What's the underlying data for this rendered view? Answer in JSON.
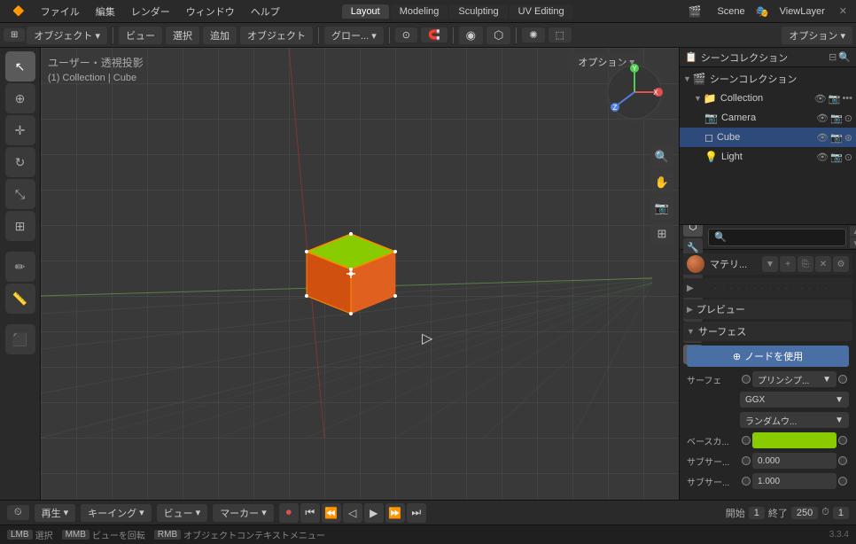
{
  "app": {
    "title": "Blender",
    "version": "3.3.4"
  },
  "top_menu": {
    "items": [
      "ブレンダー",
      "ファイル",
      "編集",
      "レンダー",
      "ウィンドウ",
      "ヘルプ"
    ]
  },
  "workspace_tabs": [
    {
      "label": "Layout",
      "active": true
    },
    {
      "label": "Modeling",
      "active": false
    },
    {
      "label": "Sculpting",
      "active": false
    },
    {
      "label": "UV Editing",
      "active": false
    }
  ],
  "scene_label": "Scene",
  "viewlayer_label": "ViewLayer",
  "second_toolbar": {
    "mode_btn": "オブジェクト ▾",
    "view_btn": "ビュー",
    "select_btn": "選択",
    "add_btn": "追加",
    "object_btn": "オブジェクト",
    "transform_btn": "グロー... ▾",
    "snap_btn": "⌖",
    "options_btn": "オプション ▾"
  },
  "viewport": {
    "view_label": "ユーザー・透視投影",
    "collection_label": "(1) Collection | Cube",
    "overlay_btn": "オーバーレイ",
    "gizmo": {
      "x": "X",
      "y": "Y",
      "z": "Z"
    }
  },
  "outliner": {
    "title": "シーンコレクション",
    "items": [
      {
        "label": "Collection",
        "icon": "📁",
        "level": 0,
        "expanded": true,
        "selected": false
      },
      {
        "label": "Camera",
        "icon": "📷",
        "level": 1,
        "selected": false
      },
      {
        "label": "Cube",
        "icon": "◻",
        "level": 1,
        "selected": true
      },
      {
        "label": "Light",
        "icon": "💡",
        "level": 1,
        "selected": false
      }
    ]
  },
  "properties": {
    "active_tab": "material",
    "search_placeholder": "🔍",
    "sections": {
      "material_header": "マテリ...",
      "preview_label": "プレビュー",
      "surface_label": "サーフェス",
      "use_nodes_label": "ノードを使用",
      "surface_type_label": "サーフェ",
      "surface_type_value": "プリンシプ...",
      "distribution_label": "GGX",
      "randomwalk_label": "ランダムウ...",
      "basecolor_label": "ベースカ...",
      "basecolor_value": "",
      "subsurface_label": "サブサー...",
      "subsurface_value": "0.000",
      "subsurface2_label": "サブサー...",
      "subsurface2_value": "1.000"
    }
  },
  "bottom_bar": {
    "play_label": "再生",
    "keying_label": "キーイング",
    "view_label": "ビュー",
    "marker_label": "マーカー",
    "frame_start": "1",
    "frame_end": "250",
    "frame_current": "1",
    "start_label": "開始",
    "end_label": "終了"
  },
  "status_bar": {
    "select_label": "選択",
    "rotate_label": "ビューを回転",
    "context_label": "オブジェクトコンテキストメニュー",
    "version": "3.3.4"
  }
}
